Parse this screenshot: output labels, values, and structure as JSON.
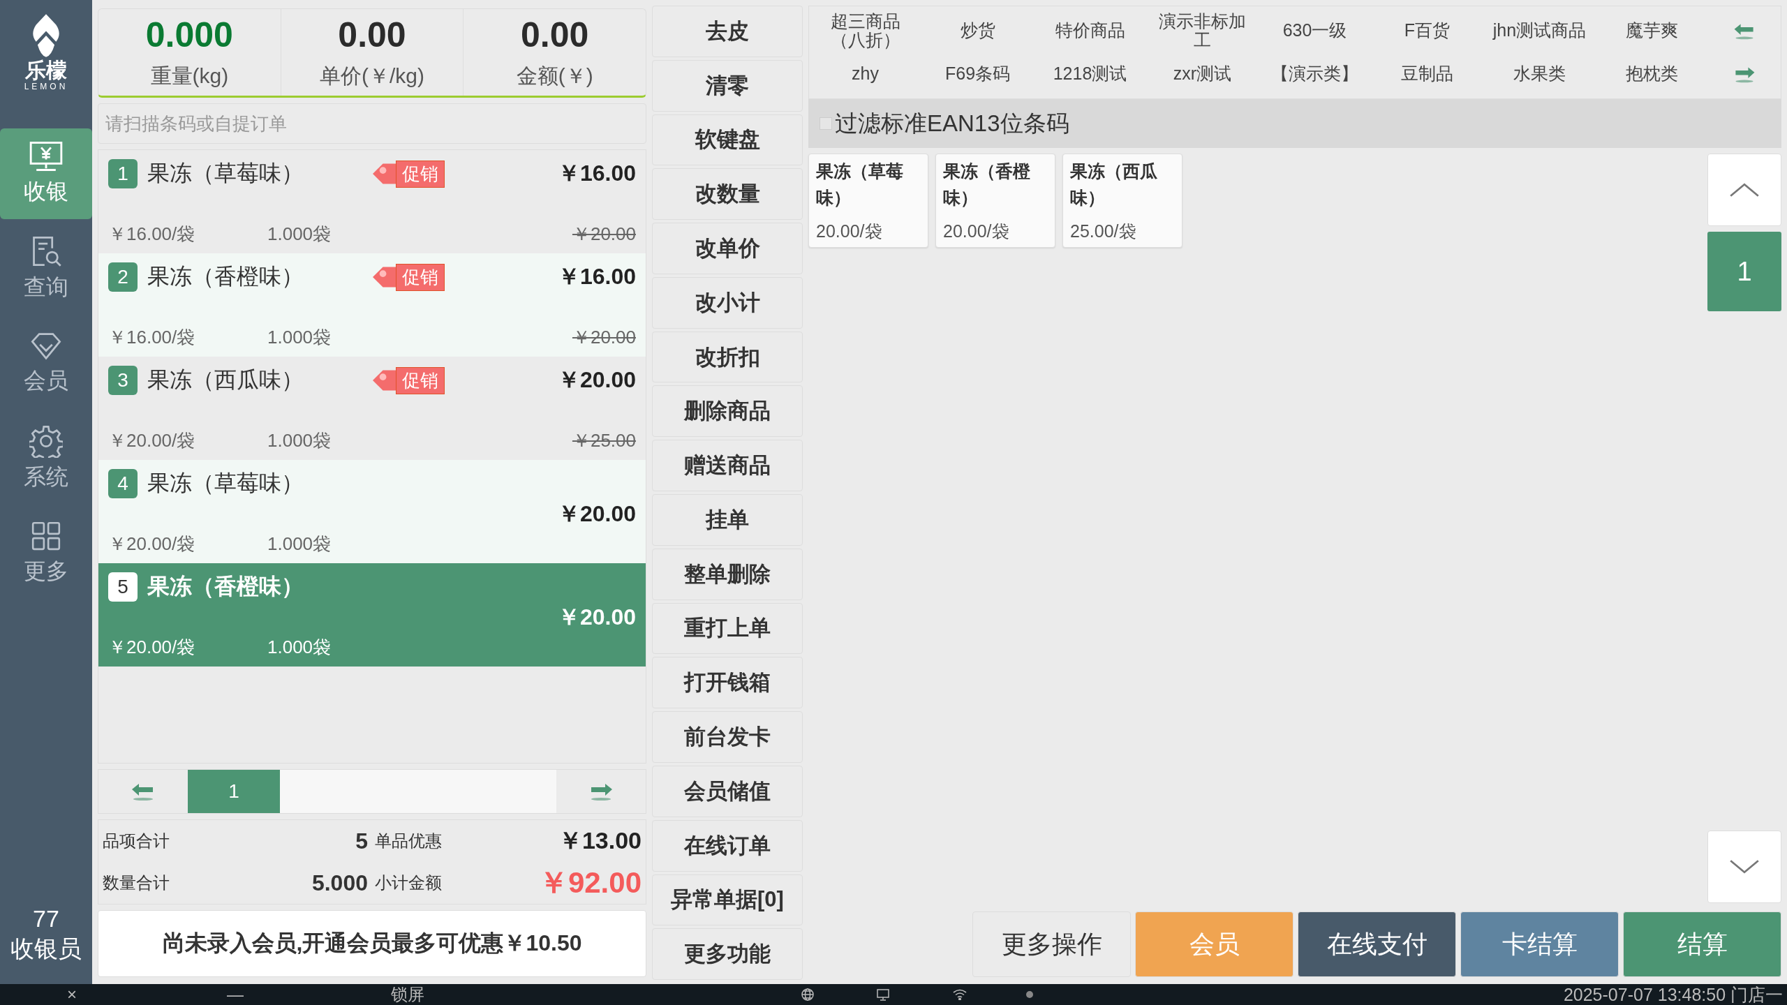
{
  "logo": {
    "name": "乐檬",
    "subtitle": "LEMON"
  },
  "nav": [
    {
      "label": "收银",
      "kind": "register",
      "selected": true
    },
    {
      "label": "查询",
      "kind": "query",
      "selected": false
    },
    {
      "label": "会员",
      "kind": "member",
      "selected": false
    },
    {
      "label": "系统",
      "kind": "system",
      "selected": false
    },
    {
      "label": "更多",
      "kind": "more",
      "selected": false
    }
  ],
  "operator": {
    "id": "77",
    "role": "收银员"
  },
  "scale": [
    {
      "value": "0.000",
      "label": "重量(kg)",
      "emphasis": true
    },
    {
      "value": "0.00",
      "label": "单价(￥/kg)",
      "emphasis": false
    },
    {
      "value": "0.00",
      "label": "金额(￥)",
      "emphasis": false
    }
  ],
  "search": {
    "placeholder": "请扫描条码或自提订单"
  },
  "items": [
    {
      "no": "1",
      "name": "果冻（草莓味）",
      "promo": "促销",
      "price": "￥16.00",
      "unit_price": "￥16.00/袋",
      "qty": "1.000袋",
      "original_price": "￥20.00",
      "selected": false
    },
    {
      "no": "2",
      "name": "果冻（香橙味）",
      "promo": "促销",
      "price": "￥16.00",
      "unit_price": "￥16.00/袋",
      "qty": "1.000袋",
      "original_price": "￥20.00",
      "selected": false
    },
    {
      "no": "3",
      "name": "果冻（西瓜味）",
      "promo": "促销",
      "price": "￥20.00",
      "unit_price": "￥20.00/袋",
      "qty": "1.000袋",
      "original_price": "￥25.00",
      "selected": false
    },
    {
      "no": "4",
      "name": "果冻（草莓味）",
      "price": "￥20.00",
      "unit_price": "￥20.00/袋",
      "qty": "1.000袋",
      "selected": false
    },
    {
      "no": "5",
      "name": "果冻（香橙味）",
      "price": "￥20.00",
      "unit_price": "￥20.00/袋",
      "qty": "1.000袋",
      "selected": true
    }
  ],
  "pager": {
    "page": "1"
  },
  "totals": {
    "items_label": "品项合计",
    "items_value": "5",
    "discount_label": "单品优惠",
    "discount_value": "￥13.00",
    "qty_label": "数量合计",
    "qty_value": "5.000",
    "subtotal_label": "小计金额",
    "subtotal_value": "￥92.00"
  },
  "member_notice": "尚未录入会员,开通会员最多可优惠￥10.50",
  "functions": [
    "去皮",
    "清零",
    "软键盘",
    "改数量",
    "改单价",
    "改小计",
    "改折扣",
    "删除商品",
    "赠送商品",
    "挂单",
    "整单删除",
    "重打上单",
    "打开钱箱",
    "前台发卡",
    "会员储值",
    "在线订单",
    "异常单据[0]",
    "更多功能"
  ],
  "categories": [
    [
      "超三商品（八折）",
      "炒货",
      "特价商品",
      "演示非标加工",
      "630一级",
      "F百货",
      "jhn测试商品",
      "魔芋爽"
    ],
    [
      "zhy",
      "F69条码",
      "1218测试",
      "zxr测试",
      "【演示类】",
      "豆制品",
      "水果类",
      "抱枕类"
    ]
  ],
  "filter": {
    "label": "过滤标准EAN13位条码",
    "checked": false
  },
  "products": [
    {
      "name": "果冻（草莓味）",
      "price": "20.00/袋"
    },
    {
      "name": "果冻（香橙味）",
      "price": "20.00/袋"
    },
    {
      "name": "果冻（西瓜味）",
      "price": "25.00/袋"
    }
  ],
  "product_page": "1",
  "actions": [
    {
      "label": "更多操作",
      "color": "#ebebeb"
    },
    {
      "label": "会员",
      "color": "#f0a451"
    },
    {
      "label": "在线支付",
      "color": "#485a6a"
    },
    {
      "label": "卡结算",
      "color": "#5f84a0"
    },
    {
      "label": "结算",
      "color": "#4c9573"
    }
  ],
  "taskbar": {
    "close": "×",
    "minimize": "—",
    "lock": "锁屏",
    "status": "2025-07-07 13:48:50 门店一"
  }
}
